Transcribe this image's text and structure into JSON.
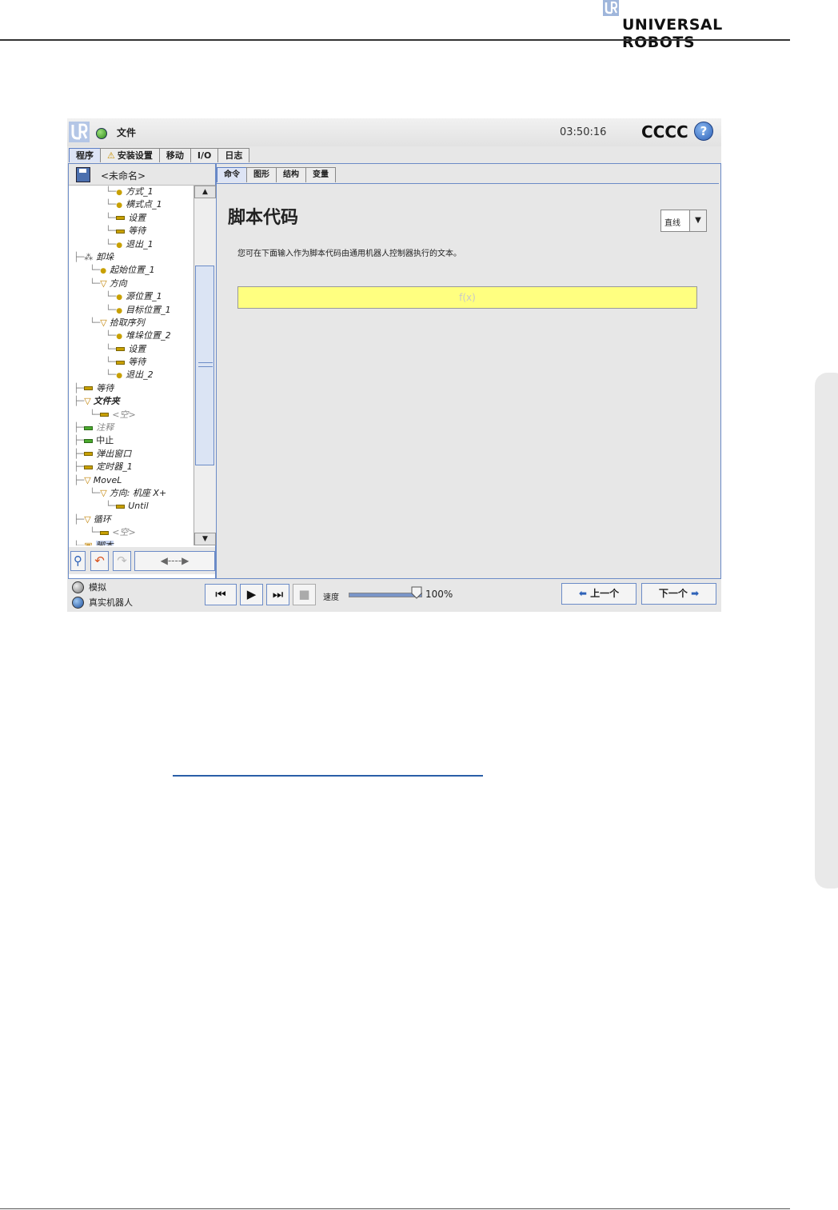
{
  "brand": {
    "name": "UNIVERSAL ROBOTS"
  },
  "titlebar": {
    "file_menu": "文件",
    "clock": "03:50:16",
    "robot_name": "CCCC",
    "help_glyph": "?"
  },
  "main_tabs": [
    {
      "label": "程序",
      "active": true
    },
    {
      "label": "安装设置",
      "warning": true
    },
    {
      "label": "移动"
    },
    {
      "label": "I/O"
    },
    {
      "label": "日志"
    }
  ],
  "program": {
    "name": "<未命名>"
  },
  "tree": [
    {
      "label": "方式_1",
      "icon": "dot",
      "indent": 4
    },
    {
      "label": "横式点_1",
      "icon": "dot",
      "indent": 4
    },
    {
      "label": "设置",
      "icon": "bar",
      "indent": 4
    },
    {
      "label": "等待",
      "icon": "bar",
      "indent": 4
    },
    {
      "label": "退出_1",
      "icon": "dot",
      "indent": 4
    },
    {
      "label": "卸垛",
      "icon": "pallet",
      "indent": 0
    },
    {
      "label": "起始位置_1",
      "icon": "dot",
      "indent": 2
    },
    {
      "label": "方向",
      "icon": "tri",
      "indent": 2
    },
    {
      "label": "源位置_1",
      "icon": "dot",
      "indent": 4
    },
    {
      "label": "目标位置_1",
      "icon": "dot",
      "indent": 4
    },
    {
      "label": "拾取序列",
      "icon": "tri",
      "indent": 2
    },
    {
      "label": "堆垛位置_2",
      "icon": "dot",
      "indent": 4
    },
    {
      "label": "设置",
      "icon": "bar",
      "indent": 4
    },
    {
      "label": "等待",
      "icon": "bar",
      "indent": 4
    },
    {
      "label": "退出_2",
      "icon": "dot",
      "indent": 4
    },
    {
      "label": "等待",
      "icon": "bar",
      "indent": 0
    },
    {
      "label": "文件夹",
      "icon": "tri",
      "indent": 0,
      "bold": true
    },
    {
      "label": "<空>",
      "icon": "bar",
      "indent": 2,
      "grey": true
    },
    {
      "label": "注释",
      "icon": "bar-green",
      "indent": 0,
      "grey": true
    },
    {
      "label": "中止",
      "icon": "bar-green",
      "indent": 0,
      "normal": true
    },
    {
      "label": "弹出窗口",
      "icon": "bar",
      "indent": 0
    },
    {
      "label": "定时器_1",
      "icon": "bar",
      "indent": 0
    },
    {
      "label": "MoveL",
      "icon": "tri",
      "indent": 0
    },
    {
      "label": "方向: 机座 X+",
      "icon": "tri",
      "indent": 2
    },
    {
      "label": "Until",
      "icon": "bar",
      "indent": 4
    },
    {
      "label": "循环",
      "icon": "tri",
      "indent": 0
    },
    {
      "label": "<空>",
      "icon": "bar",
      "indent": 2,
      "grey": true
    },
    {
      "label": "脚本",
      "icon": "script",
      "indent": 0,
      "selected": true
    }
  ],
  "sub_tabs": [
    {
      "label": "命令",
      "active": true
    },
    {
      "label": "图形"
    },
    {
      "label": "结构"
    },
    {
      "label": "变量"
    }
  ],
  "script": {
    "heading": "脚本代码",
    "mode": "直线",
    "description": "您可在下面输入作为脚本代码由通用机器人控制器执行的文本。",
    "field_placeholder": "f(x)"
  },
  "run_mode": {
    "simulate": "模拟",
    "real_robot": "真实机器人"
  },
  "speed": {
    "label": "速度",
    "value": "100%",
    "level": 1.0
  },
  "nav": {
    "prev": "上一个",
    "next": "下一个"
  },
  "colors": {
    "accent": "#6b8bc7",
    "script_field": "#ffff80",
    "status_ok": "#2e8a1a"
  }
}
